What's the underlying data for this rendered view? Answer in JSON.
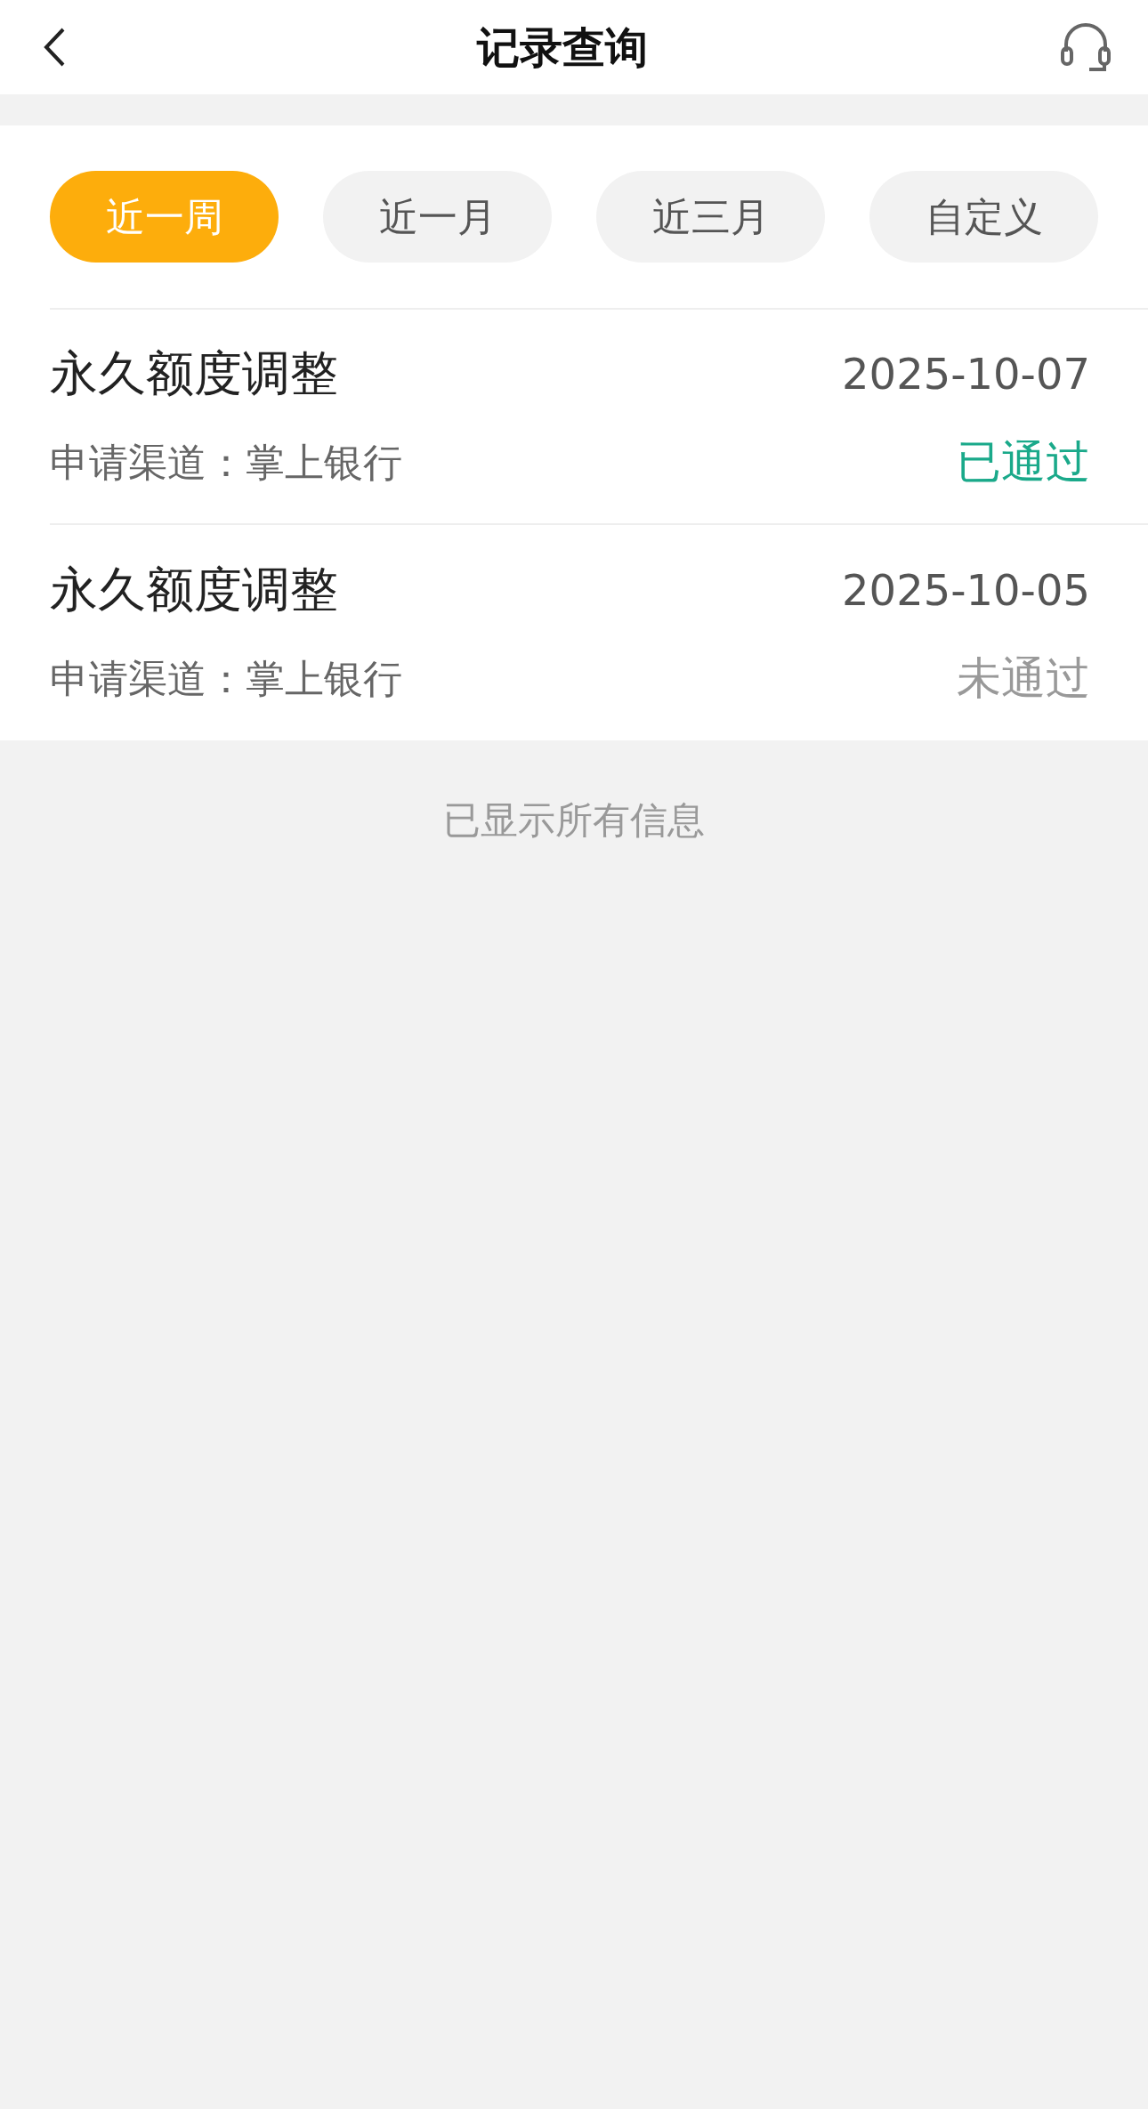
{
  "header": {
    "title": "记录查询"
  },
  "tabs": [
    {
      "label": "近一周",
      "selected": true
    },
    {
      "label": "近一月",
      "selected": false
    },
    {
      "label": "近三月",
      "selected": false
    },
    {
      "label": "自定义",
      "selected": false
    }
  ],
  "records": [
    {
      "title": "永久额度调整",
      "date": "2025-10-07",
      "channel": "申请渠道：掌上银行",
      "status": "已通过",
      "kind": "approved"
    },
    {
      "title": "永久额度调整",
      "date": "2025-10-05",
      "channel": "申请渠道：掌上银行",
      "status": "未通过",
      "kind": "rejected"
    }
  ],
  "footer_note": "已显示所有信息"
}
